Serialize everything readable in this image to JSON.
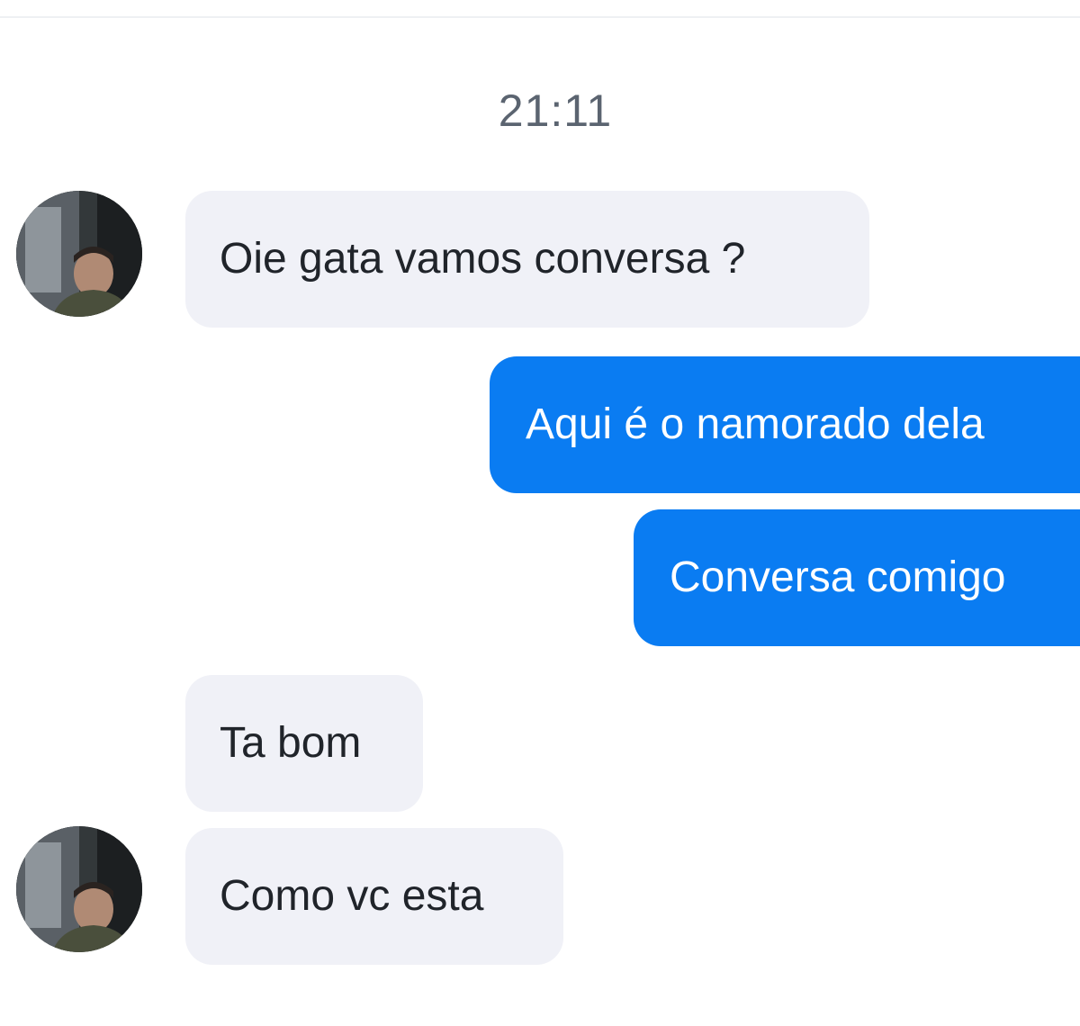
{
  "conversation": {
    "timestamp": "21:11",
    "messages": [
      {
        "direction": "incoming",
        "text": "Oie gata vamos conversa ?"
      },
      {
        "direction": "outgoing",
        "text": "Aqui é o namorado dela"
      },
      {
        "direction": "outgoing",
        "text": "Conversa comigo"
      },
      {
        "direction": "incoming",
        "text": "Ta bom"
      },
      {
        "direction": "incoming",
        "text": "Como vc esta"
      }
    ]
  },
  "colors": {
    "incoming_bubble": "#f0f1f7",
    "outgoing_bubble": "#0a7cf2",
    "timestamp_text": "#5b6470"
  }
}
